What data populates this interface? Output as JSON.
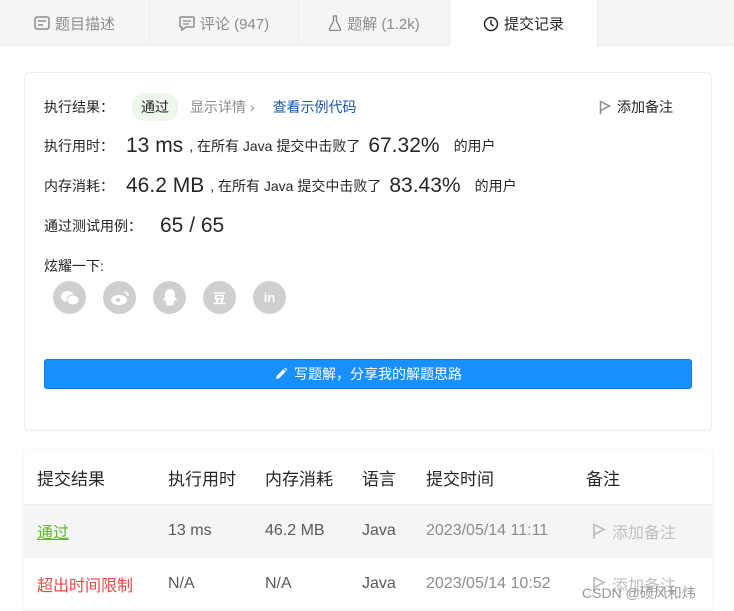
{
  "tabs": [
    {
      "label": "题目描述",
      "icon": "description-icon"
    },
    {
      "label": "评论 (947)",
      "icon": "comment-icon"
    },
    {
      "label": "题解 (1.2k)",
      "icon": "flask-icon"
    },
    {
      "label": "提交记录",
      "icon": "clock-icon"
    }
  ],
  "result": {
    "status_label": "执行结果：",
    "status_value": "通过",
    "details_label": "显示详情 ›",
    "view_code_label": "查看示例代码",
    "add_note_label": "添加备注",
    "runtime_label": "执行用时：",
    "runtime_value": "13 ms",
    "runtime_text": ", 在所有 Java 提交中击败了",
    "runtime_pct": "67.32%",
    "users_text": "的用户",
    "memory_label": "内存消耗：",
    "memory_value": "46.2 MB",
    "memory_text": ", 在所有 Java 提交中击败了",
    "memory_pct": "83.43%",
    "tests_label": "通过测试用例：",
    "tests_value": "65 / 65",
    "share_label": "炫耀一下:",
    "share_icons": [
      "wechat-icon",
      "weibo-icon",
      "qq-icon",
      "douban-icon",
      "linkedin-icon"
    ],
    "douban_glyph": "豆",
    "linkedin_glyph": "in",
    "solution_button": "写题解，分享我的解题思路"
  },
  "table": {
    "headers": [
      "提交结果",
      "执行用时",
      "内存消耗",
      "语言",
      "提交时间",
      "备注"
    ],
    "rows": [
      {
        "status": "通过",
        "runtime": "13 ms",
        "memory": "46.2 MB",
        "language": "Java",
        "time": "2023/05/14 11:11",
        "note": "添加备注"
      },
      {
        "status": "超出时间限制",
        "runtime": "N/A",
        "memory": "N/A",
        "language": "Java",
        "time": "2023/05/14 10:52",
        "note": "添加备注"
      }
    ]
  },
  "watermark": "CSDN @硕风和炜",
  "colors": {
    "accepted": "#5cb82d",
    "tle": "#ef4743",
    "primary": "#1890ff",
    "link": "#1a56a8"
  }
}
